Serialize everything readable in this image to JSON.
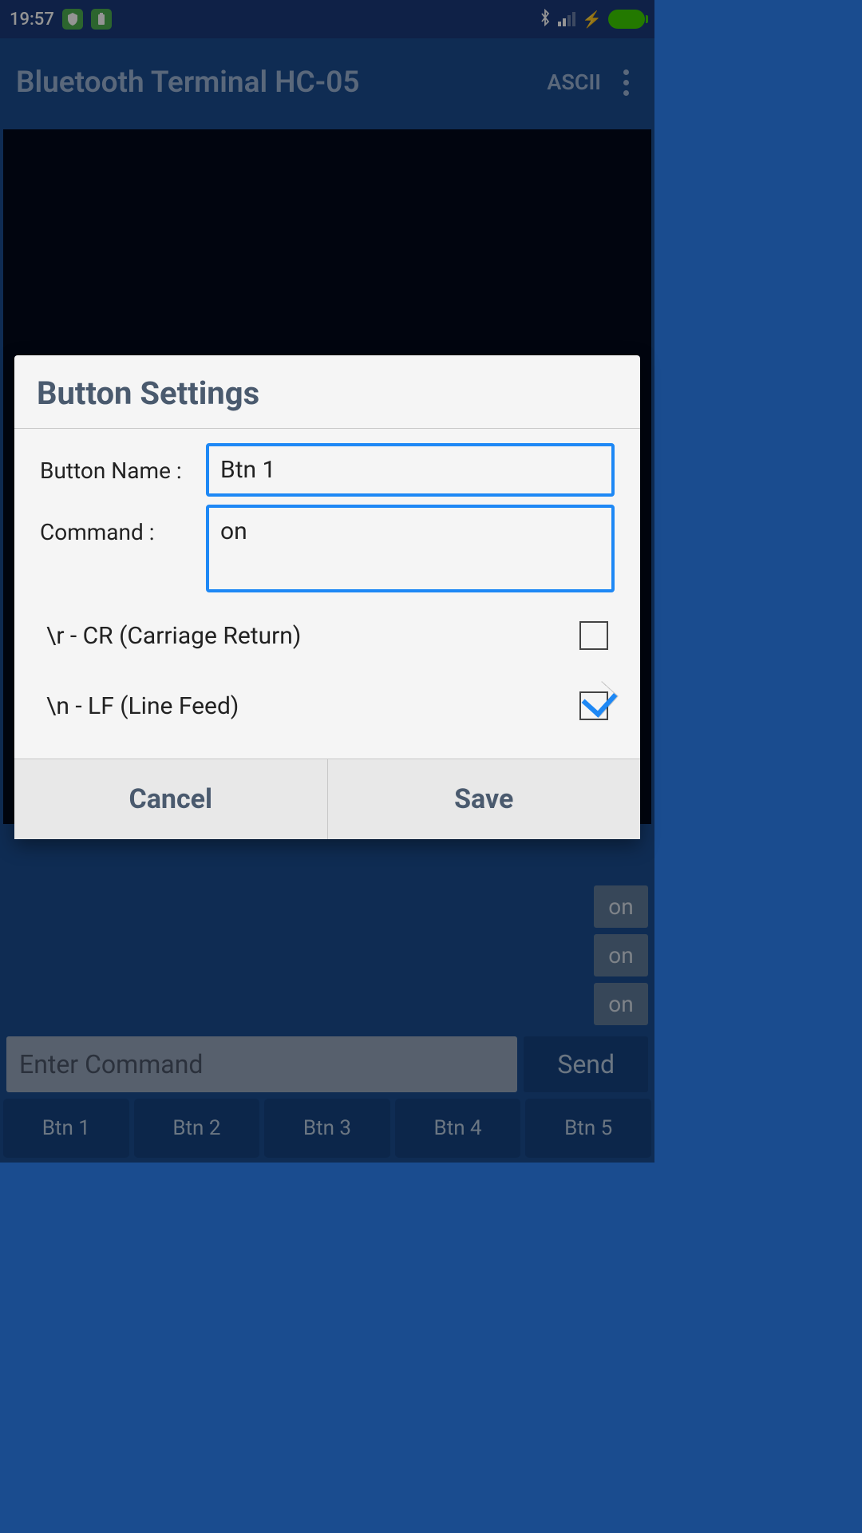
{
  "status": {
    "time": "19:57"
  },
  "app": {
    "title": "Bluetooth Terminal HC-05",
    "mode": "ASCII"
  },
  "history": {
    "items": [
      "on",
      "on",
      "on"
    ]
  },
  "command": {
    "placeholder": "Enter Command",
    "send_label": "Send"
  },
  "presets": {
    "btn1": "Btn 1",
    "btn2": "Btn 2",
    "btn3": "Btn 3",
    "btn4": "Btn 4",
    "btn5": "Btn 5"
  },
  "dialog": {
    "title": "Button Settings",
    "name_label": "Button Name :",
    "name_value": "Btn 1",
    "command_label": "Command      :",
    "command_value": "on",
    "cr_label": "\\r - CR (Carriage Return)",
    "lf_label": "\\n - LF (Line Feed)",
    "cancel": "Cancel",
    "save": "Save"
  }
}
